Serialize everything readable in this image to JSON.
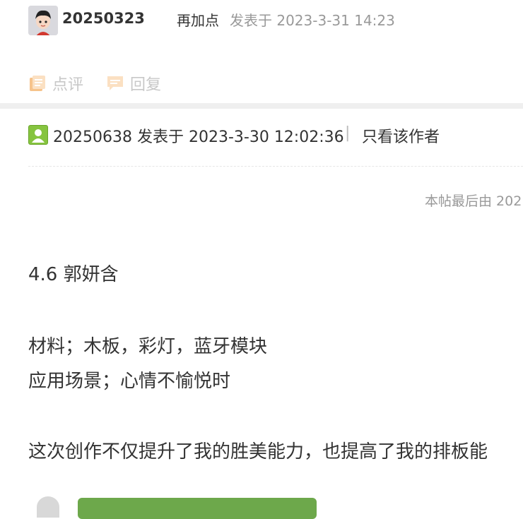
{
  "reply": {
    "username": "20250323",
    "text": "再加点",
    "meta": "发表于 2023-3-31 14:23"
  },
  "actions": {
    "comment_label": "点评",
    "reply_label": "回复"
  },
  "post": {
    "author_line": "20250638 发表于 2023-3-30 12:02:36",
    "separator": "|",
    "only_author_label": "只看该作者",
    "edit_note": "本帖最后由 202"
  },
  "content": {
    "title": "4.6  郭妍含",
    "materials": "材料；木板，彩灯，蓝牙模块",
    "scene": "应用场景；心情不愉悦时",
    "reflection": "这次创作不仅提升了我的胜美能力，也提高了我的排板能"
  },
  "colors": {
    "accent_green": "#6da84b",
    "icon_orange": "#f6c38b",
    "muted": "#999999"
  },
  "icons": {
    "avatar": "user-avatar-cartoon",
    "comment": "comment-note-icon",
    "reply": "reply-bubble-icon",
    "user": "user-icon"
  }
}
